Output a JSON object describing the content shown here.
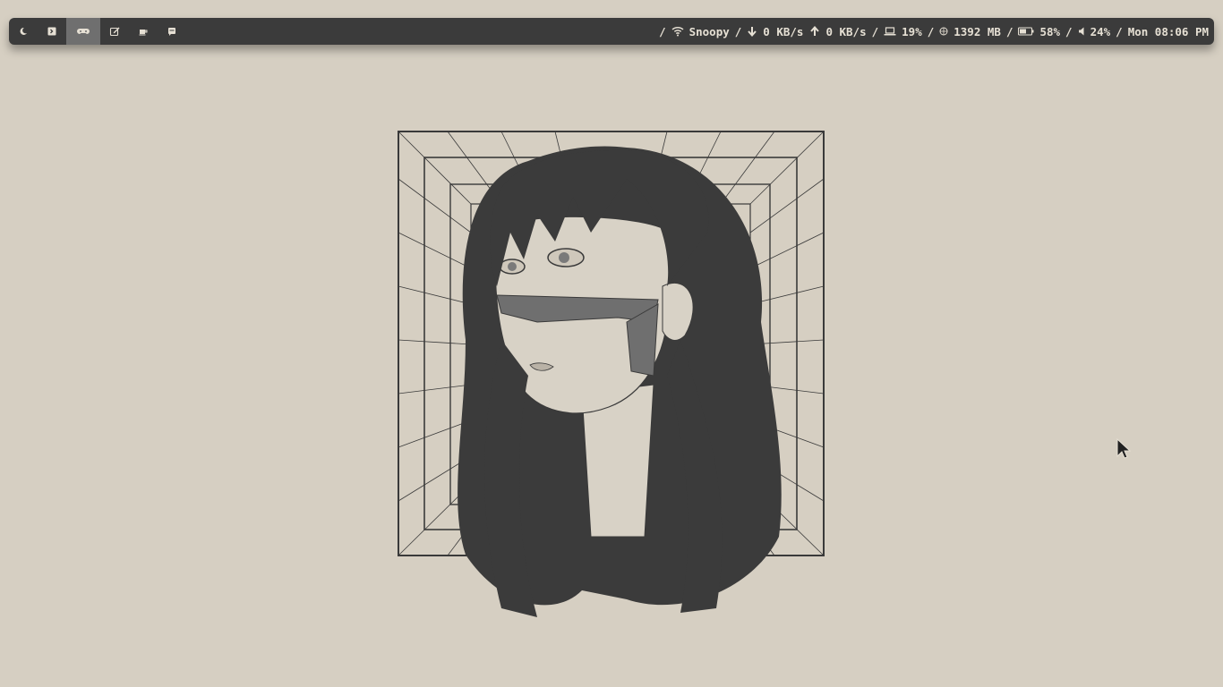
{
  "workspaces": [
    {
      "icon": "moon-icon",
      "active": false
    },
    {
      "icon": "terminal-icon",
      "active": false
    },
    {
      "icon": "gamepad-icon",
      "active": true
    },
    {
      "icon": "edit-icon",
      "active": false
    },
    {
      "icon": "coffee-icon",
      "active": false
    },
    {
      "icon": "chat-icon",
      "active": false
    }
  ],
  "status": {
    "separator": "/",
    "wifi": {
      "icon": "wifi-icon",
      "label": "Snoopy"
    },
    "download": {
      "icon": "arrow-down-icon",
      "label": "0 KB/s"
    },
    "upload": {
      "icon": "arrow-up-icon",
      "label": "0 KB/s"
    },
    "cpu": {
      "icon": "laptop-icon",
      "label": "19%"
    },
    "memory": {
      "icon": "memory-icon",
      "label": "1392 MB"
    },
    "battery": {
      "icon": "battery-icon",
      "label": "58%"
    },
    "volume": {
      "icon": "speaker-icon",
      "label": "24%"
    },
    "clock": "Mon 08:06 PM"
  },
  "colors": {
    "desktop_bg": "#d6cfc2",
    "bar_bg": "#3b3b3b",
    "bar_text": "#e6e0d4",
    "active_workspace": "#6f6f6f"
  },
  "wallpaper": {
    "subject": "illustration-girl-in-perspective-grid"
  }
}
